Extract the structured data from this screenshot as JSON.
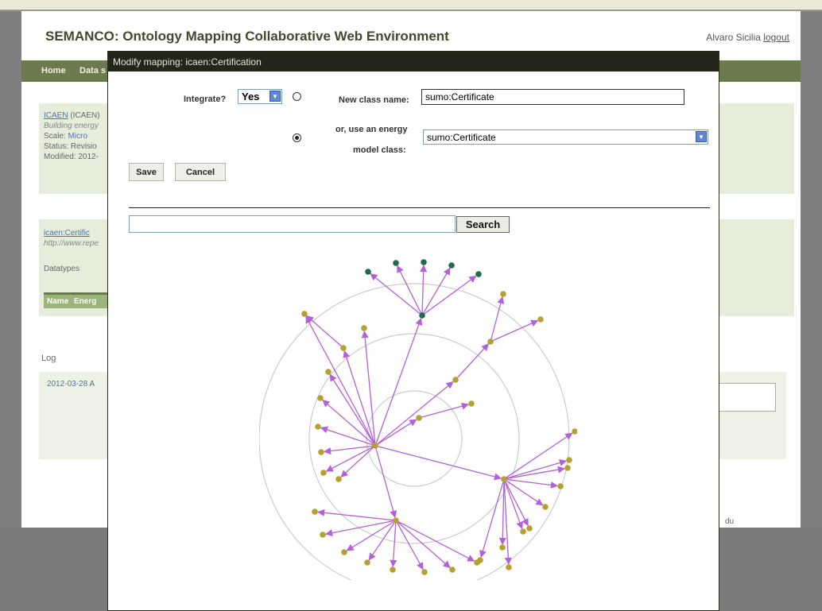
{
  "background": {
    "title": "SEMANCO: Ontology Mapping Collaborative Web Environment",
    "user": "Alvaro Sicilia",
    "logout": "logout",
    "nav": [
      "Home",
      "Data s"
    ],
    "panel1": {
      "link": "ICAEN",
      "paren": "(ICAEN)",
      "line2": "Building energy",
      "scale_label": "Scale:",
      "scale_value": "Micro",
      "status": "Status: Revisio",
      "modified": "Modified: 2012-"
    },
    "panel2": {
      "link": "icaen:Certific",
      "url": "http://www.repe",
      "datatypes": "Datatypes",
      "headers": [
        "Name",
        "Energ"
      ]
    },
    "log_label": "Log",
    "log_date": "2012-03-28",
    "log_rest": "A",
    "footer_frag": "du"
  },
  "modal": {
    "title": "Modify mapping: icaen:Certification",
    "integrate_label": "Integrate?",
    "integrate_value": "Yes",
    "new_class_label": "New class name:",
    "new_class_value": "sumo:Certificate",
    "energy_label_line1": "or, use an energy",
    "energy_label_line2": "model class:",
    "energy_class_value": "sumo:Certificate",
    "radio_new_checked": false,
    "radio_energy_checked": true,
    "save_label": "Save",
    "cancel_label": "Cancel",
    "search_value": "",
    "search_button": "Search"
  },
  "colors": {
    "edge": "#b55fd8",
    "node_yellow": "#b5a22e",
    "node_green": "#1f6b47",
    "ring": "#cccccc"
  }
}
